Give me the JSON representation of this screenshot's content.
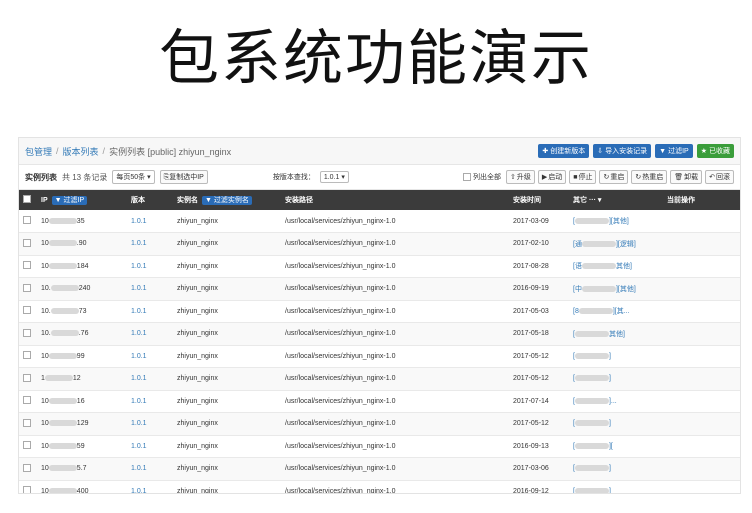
{
  "slide_title": "包系统功能演示",
  "breadcrumb": {
    "root": "包管理",
    "versions": "版本列表",
    "current": "实例列表 [public] zhiyun_nginx"
  },
  "actions": [
    "创建新版本",
    "导入安装记录",
    "过滤IP",
    "已收藏"
  ],
  "toolbar": {
    "label": "实例列表",
    "count": "共 13 条记录",
    "per_page": "每页50条",
    "copy_ip": "复制选中IP",
    "search_label": "按版本查找：",
    "version_select": "1.0.1",
    "select_all": "列出全部",
    "buttons": [
      "升级",
      "启动",
      "停止",
      "重启",
      "热重启",
      "卸载",
      "回滚"
    ]
  },
  "table": {
    "headers": {
      "ip": "IP",
      "filter_ip": "过滤IP",
      "version": "版本",
      "name": "实例名",
      "filter_name": "过滤实例名",
      "path": "安装路径",
      "time": "安装时间",
      "other": "其它 ···",
      "ops": "当前操作"
    },
    "rows": [
      {
        "ip_prefix": "10",
        "ip_suffix": "35",
        "version": "1.0.1",
        "name": "zhiyun_nginx",
        "path": "/usr/local/services/zhiyun_nginx-1.0",
        "time": "2017-03-09",
        "other_pre": "[",
        "other_suf": "][其他]"
      },
      {
        "ip_prefix": "10",
        "ip_suffix": ".90",
        "version": "1.0.1",
        "name": "zhiyun_nginx",
        "path": "/usr/local/services/zhiyun_nginx-1.0",
        "time": "2017-02-10",
        "other_pre": "[通",
        "other_suf": "][逻辑]"
      },
      {
        "ip_prefix": "10",
        "ip_suffix": "184",
        "version": "1.0.1",
        "name": "zhiyun_nginx",
        "path": "/usr/local/services/zhiyun_nginx-1.0",
        "time": "2017-08-28",
        "other_pre": "[语",
        "other_suf": "其他]"
      },
      {
        "ip_prefix": "10.",
        "ip_suffix": "240",
        "version": "1.0.1",
        "name": "zhiyun_nginx",
        "path": "/usr/local/services/zhiyun_nginx-1.0",
        "time": "2016-09-19",
        "other_pre": "[中",
        "other_suf": "][其他]"
      },
      {
        "ip_prefix": "10.",
        "ip_suffix": "73",
        "version": "1.0.1",
        "name": "zhiyun_nginx",
        "path": "/usr/local/services/zhiyun_nginx-1.0",
        "time": "2017-05-03",
        "other_pre": "[8",
        "other_suf": "][其..."
      },
      {
        "ip_prefix": "10.",
        "ip_suffix": ".76",
        "version": "1.0.1",
        "name": "zhiyun_nginx",
        "path": "/usr/local/services/zhiyun_nginx-1.0",
        "time": "2017-05-18",
        "other_pre": "[",
        "other_suf": "其他]"
      },
      {
        "ip_prefix": "10",
        "ip_suffix": "99",
        "version": "1.0.1",
        "name": "zhiyun_nginx",
        "path": "/usr/local/services/zhiyun_nginx-1.0",
        "time": "2017-05-12",
        "other_pre": "[",
        "other_suf": "]"
      },
      {
        "ip_prefix": "1",
        "ip_suffix": "12",
        "version": "1.0.1",
        "name": "zhiyun_nginx",
        "path": "/usr/local/services/zhiyun_nginx-1.0",
        "time": "2017-05-12",
        "other_pre": "[",
        "other_suf": "]"
      },
      {
        "ip_prefix": "10",
        "ip_suffix": "16",
        "version": "1.0.1",
        "name": "zhiyun_nginx",
        "path": "/usr/local/services/zhiyun_nginx-1.0",
        "time": "2017-07-14",
        "other_pre": "[",
        "other_suf": "]..."
      },
      {
        "ip_prefix": "10",
        "ip_suffix": "129",
        "version": "1.0.1",
        "name": "zhiyun_nginx",
        "path": "/usr/local/services/zhiyun_nginx-1.0",
        "time": "2017-05-12",
        "other_pre": "[",
        "other_suf": "]"
      },
      {
        "ip_prefix": "10",
        "ip_suffix": "59",
        "version": "1.0.1",
        "name": "zhiyun_nginx",
        "path": "/usr/local/services/zhiyun_nginx-1.0",
        "time": "2016-09-13",
        "other_pre": "[",
        "other_suf": "]["
      },
      {
        "ip_prefix": "10",
        "ip_suffix": "5.7",
        "version": "1.0.1",
        "name": "zhiyun_nginx",
        "path": "/usr/local/services/zhiyun_nginx-1.0",
        "time": "2017-03-06",
        "other_pre": "[",
        "other_suf": "]"
      },
      {
        "ip_prefix": "10",
        "ip_suffix": "400",
        "version": "1.0.1",
        "name": "zhiyun_nginx",
        "path": "/usr/local/services/zhiyun_nginx-1.0",
        "time": "2016-09-12",
        "other_pre": "[",
        "other_suf": "]"
      }
    ]
  }
}
